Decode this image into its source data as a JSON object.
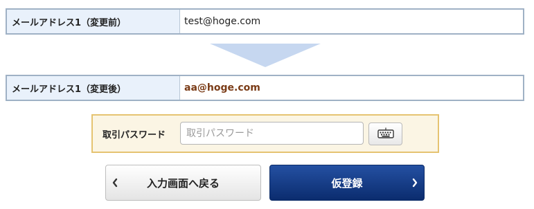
{
  "before": {
    "label": "メールアドレス1（変更前）",
    "value": "test@hoge.com"
  },
  "after": {
    "label": "メールアドレス1（変更後）",
    "value": "aa@hoge.com"
  },
  "password": {
    "label": "取引パスワード",
    "placeholder": "取引パスワード",
    "value": ""
  },
  "icons": {
    "keyboard": "keyboard-icon",
    "back_chevron": "chevron-left-icon",
    "next_chevron": "chevron-right-icon"
  },
  "buttons": {
    "back_label": "入力画面へ戻る",
    "submit_label": "仮登録"
  },
  "colors": {
    "label_bg": "#e9f1fb",
    "row_border": "#9fb1c5",
    "arrow": "#c6d7f0",
    "password_box_bg": "#fbf5e4",
    "password_box_border": "#e5c371",
    "after_value_text": "#7a3b16",
    "primary_button": "#0b2c6e"
  }
}
